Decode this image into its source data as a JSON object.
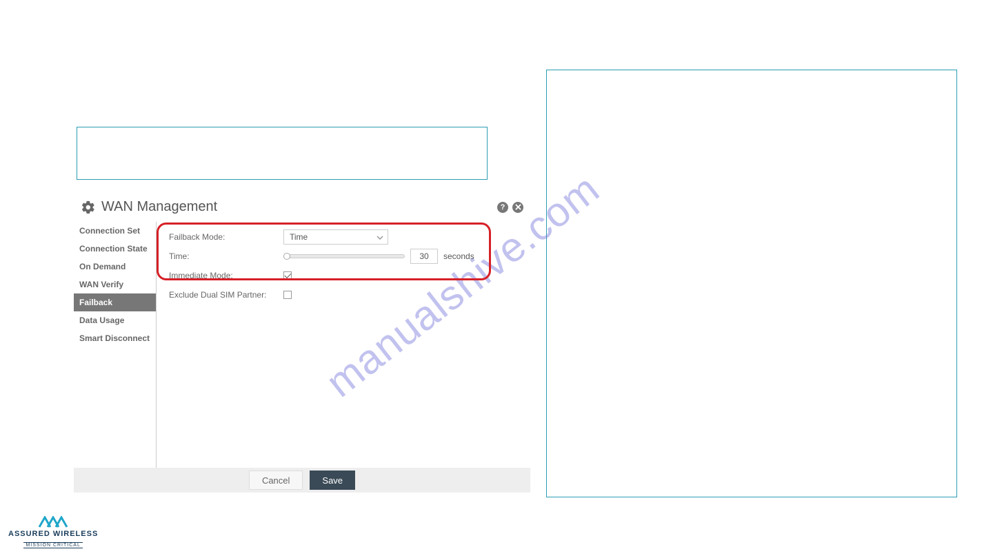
{
  "panel": {
    "title": "WAN Management"
  },
  "sidebar": {
    "items": [
      {
        "label": "Connection Set"
      },
      {
        "label": "Connection State"
      },
      {
        "label": "On Demand"
      },
      {
        "label": "WAN Verify"
      },
      {
        "label": "Failback"
      },
      {
        "label": "Data Usage"
      },
      {
        "label": "Smart Disconnect"
      }
    ]
  },
  "form": {
    "failback_mode_label": "Failback Mode:",
    "failback_mode_value": "Time",
    "time_label": "Time:",
    "time_value": "30",
    "time_unit": "seconds",
    "immediate_mode_label": "Immediate Mode:",
    "immediate_mode_checked": true,
    "exclude_dual_sim_label": "Exclude Dual SIM Partner:",
    "exclude_dual_sim_checked": false
  },
  "footer": {
    "cancel": "Cancel",
    "save": "Save"
  },
  "brand": {
    "line1": "ASSURED WIRELESS",
    "line2": "MISSION CRITICAL"
  },
  "watermark": "manualshive.com"
}
